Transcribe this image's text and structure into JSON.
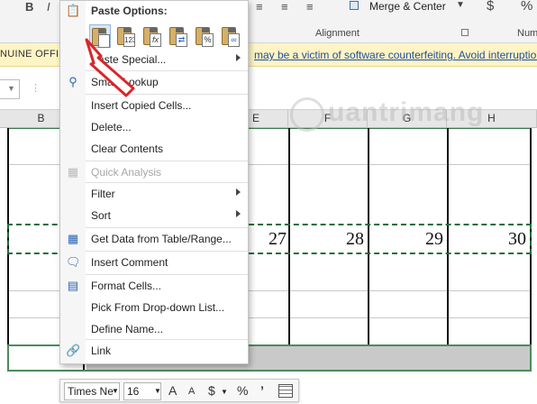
{
  "ribbon": {
    "bold": "B",
    "italic": "I",
    "merge_label": "Merge & Center",
    "alignment_group": "Alignment",
    "number_group_partial": "Num",
    "currency": "$",
    "percent": "%"
  },
  "warning": {
    "left_text": "NUINE OFFIC",
    "link_text": "may be a victim of software counterfeiting. Avoid interruption"
  },
  "columns": [
    "B",
    "E",
    "F",
    "G",
    "H"
  ],
  "cells": {
    "n27": "27",
    "n28": "28",
    "n29": "29",
    "n30": "30"
  },
  "watermark": "uantrimang",
  "context_menu": {
    "paste_options_title": "Paste Options:",
    "paste_icons": [
      "paste",
      "values-123",
      "formulas-fx",
      "transpose",
      "formatting-percent",
      "link"
    ],
    "items": [
      {
        "label": "Paste Special...",
        "submenu": true,
        "enabled": true
      },
      {
        "label": "Smart Lookup",
        "enabled": true
      },
      {
        "label": "Insert Copied Cells...",
        "enabled": true
      },
      {
        "label": "Delete...",
        "enabled": true
      },
      {
        "label": "Clear Contents",
        "enabled": true
      },
      {
        "label": "Quick Analysis",
        "enabled": false
      },
      {
        "label": "Filter",
        "submenu": true,
        "enabled": true
      },
      {
        "label": "Sort",
        "submenu": true,
        "enabled": true
      },
      {
        "label": "Get Data from Table/Range...",
        "enabled": true
      },
      {
        "label": "Insert Comment",
        "enabled": true
      },
      {
        "label": "Format Cells...",
        "enabled": true
      },
      {
        "label": "Pick From Drop-down List...",
        "enabled": true
      },
      {
        "label": "Define Name...",
        "enabled": true
      },
      {
        "label": "Link",
        "enabled": true
      }
    ]
  },
  "mini_toolbar": {
    "font_name": "Times Ne",
    "font_size": "16",
    "grow_font": "A",
    "shrink_font": "A",
    "currency": "$",
    "percent": "%",
    "comma": "’"
  },
  "colors": {
    "accent_green": "#1f6d3f",
    "warning_bg": "#fff4c4",
    "annotation_red": "#d9262b"
  }
}
